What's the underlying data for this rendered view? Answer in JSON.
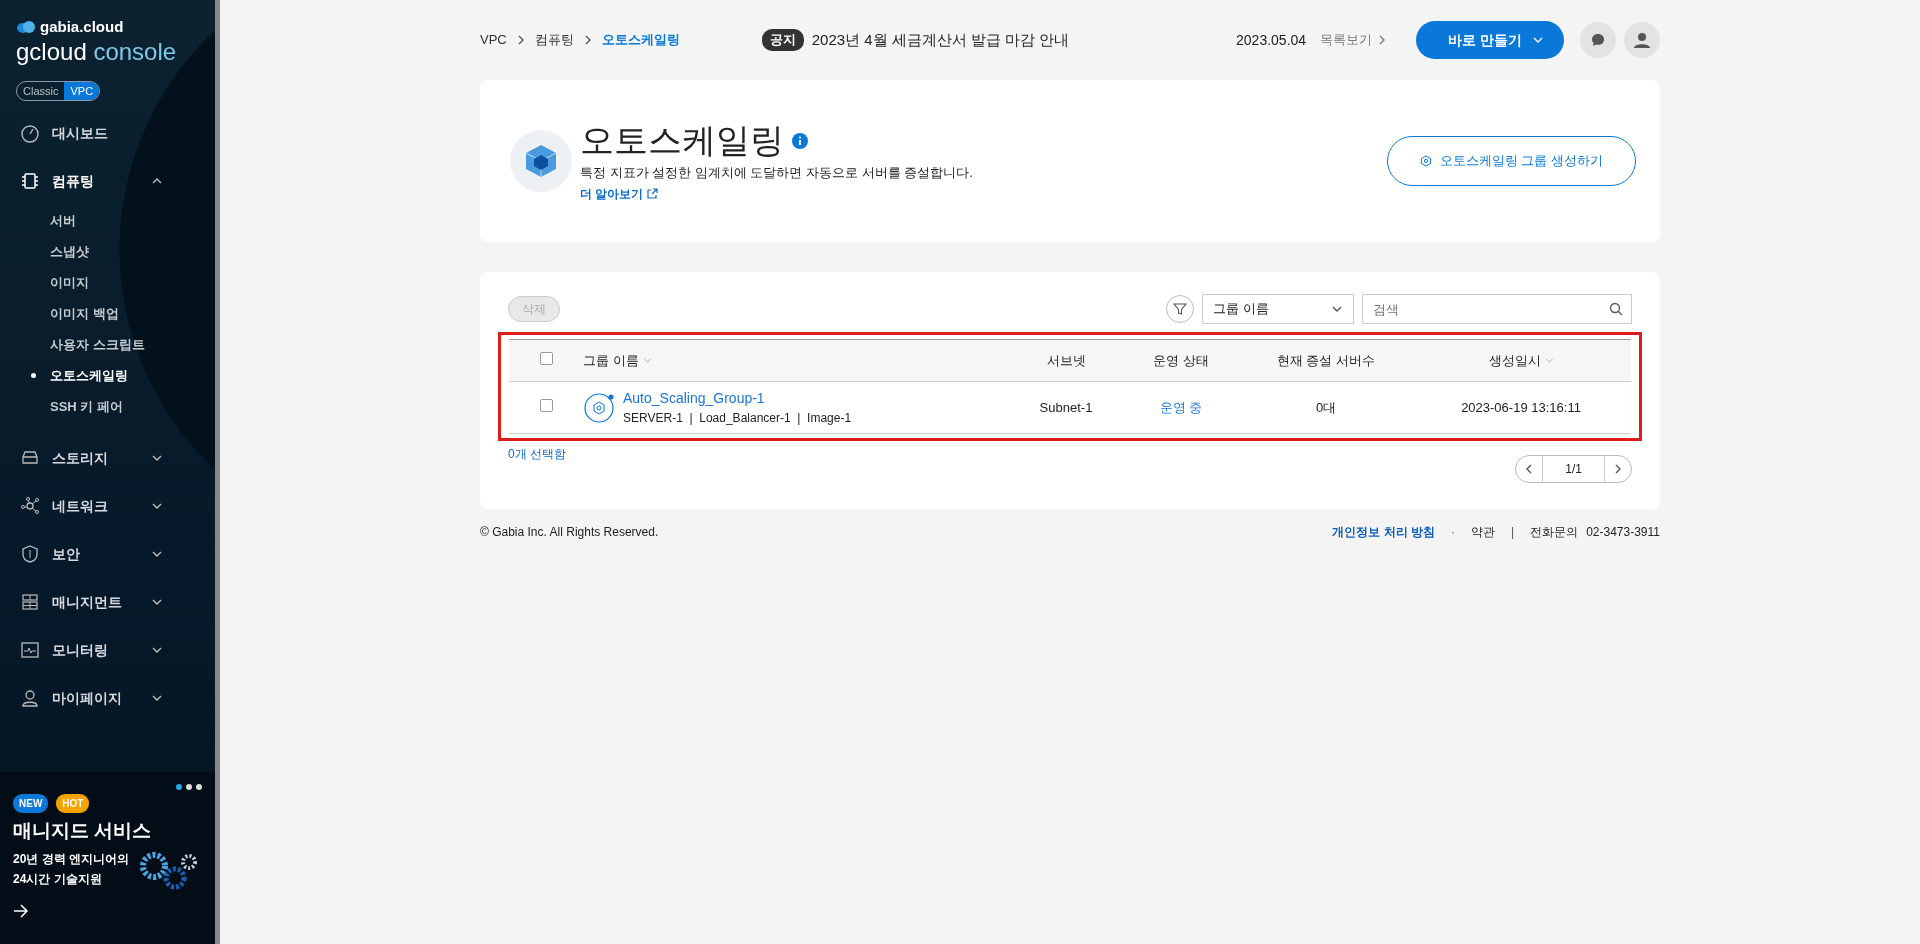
{
  "sidebar": {
    "brand": "gabia.cloud",
    "console_title": "gcloud",
    "console_suffix": "console",
    "mode_toggle": [
      {
        "label": "Classic",
        "selected": false
      },
      {
        "label": "VPC",
        "selected": true
      }
    ],
    "items": [
      {
        "kind": "dashboard",
        "label": "대시보드"
      },
      {
        "kind": "computing",
        "label": "컴퓨팅",
        "expanded": true,
        "children": [
          {
            "label": "서버",
            "selected": false
          },
          {
            "label": "스냅샷",
            "selected": false
          },
          {
            "label": "이미지",
            "selected": false
          },
          {
            "label": "이미지 백업",
            "selected": false
          },
          {
            "label": "사용자 스크립트",
            "selected": false
          },
          {
            "label": "오토스케일링",
            "selected": true
          },
          {
            "label": "SSH 키 페어",
            "selected": false
          }
        ]
      },
      {
        "kind": "storage",
        "label": "스토리지",
        "expanded": false
      },
      {
        "kind": "network",
        "label": "네트워크",
        "expanded": false
      },
      {
        "kind": "security",
        "label": "보안",
        "expanded": false
      },
      {
        "kind": "management",
        "label": "매니지먼트",
        "expanded": false
      },
      {
        "kind": "monitoring",
        "label": "모니터링",
        "expanded": false
      },
      {
        "kind": "mypage",
        "label": "마이페이지",
        "expanded": false
      }
    ],
    "banner": {
      "dots": [
        {
          "selected": true
        },
        {
          "selected": false
        },
        {
          "selected": false
        }
      ],
      "badges": [
        {
          "label": "NEW",
          "color": "#0a78d8"
        },
        {
          "label": "HOT",
          "color": "#f5a300"
        }
      ],
      "title": "매니지드 서비스",
      "lines": [
        "20년 경력 엔지니어의",
        "24시간 기술지원"
      ]
    }
  },
  "header": {
    "breadcrumb": [
      {
        "label": "VPC",
        "current": false
      },
      {
        "label": "컴퓨팅",
        "current": false
      },
      {
        "label": "오토스케일링",
        "current": true
      }
    ],
    "notice_badge": "공지",
    "notice": "2023년 4월 세금계산서 발급 마감 안내",
    "notice_date": "2023.05.04",
    "list_link": "목록보기",
    "create_button": "바로 만들기"
  },
  "page_header": {
    "title": "오토스케일링",
    "description": "특정 지표가 설정한 임계치에 도달하면 자동으로 서버를 증설합니다.",
    "learn_more": "더 알아보기",
    "create_group_button": "오토스케일링 그룹 생성하기"
  },
  "toolbar": {
    "delete_button": {
      "label": "삭제",
      "disabled": true
    },
    "filter_select": "그룹 이름",
    "search": {
      "placeholder": "검색"
    }
  },
  "table": {
    "highlighted": true,
    "columns": [
      {
        "label": "그룹 이름",
        "sortable": true
      },
      {
        "label": "서브넷",
        "sortable": false
      },
      {
        "label": "운영 상태",
        "sortable": false
      },
      {
        "label": "현재 증설 서버수",
        "sortable": false
      },
      {
        "label": "생성일시",
        "sortable": true
      }
    ],
    "header_checked": false,
    "rows": [
      {
        "checked": false,
        "name": "Auto_Scaling_Group-1",
        "details": "SERVER-1  |  Load_Balancer-1  |  Image-1",
        "subnet": "Subnet-1",
        "status": "운영 중",
        "server_count": "0대",
        "created": "2023-06-19 13:16:11"
      }
    ],
    "selected_count": "0개 선택함",
    "page": "1/1"
  },
  "footer": {
    "copyright": "© Gabia Inc. All Rights Reserved.",
    "items": [
      {
        "kind": "link",
        "label": "개인정보 처리 방침"
      },
      {
        "kind": "separator",
        "label": "·"
      },
      {
        "kind": "plain",
        "label": "약관"
      },
      {
        "kind": "separator",
        "label": "|"
      },
      {
        "kind": "plain",
        "label": "전화문의"
      },
      {
        "kind": "phone",
        "label": "02-3473-3911"
      }
    ]
  }
}
